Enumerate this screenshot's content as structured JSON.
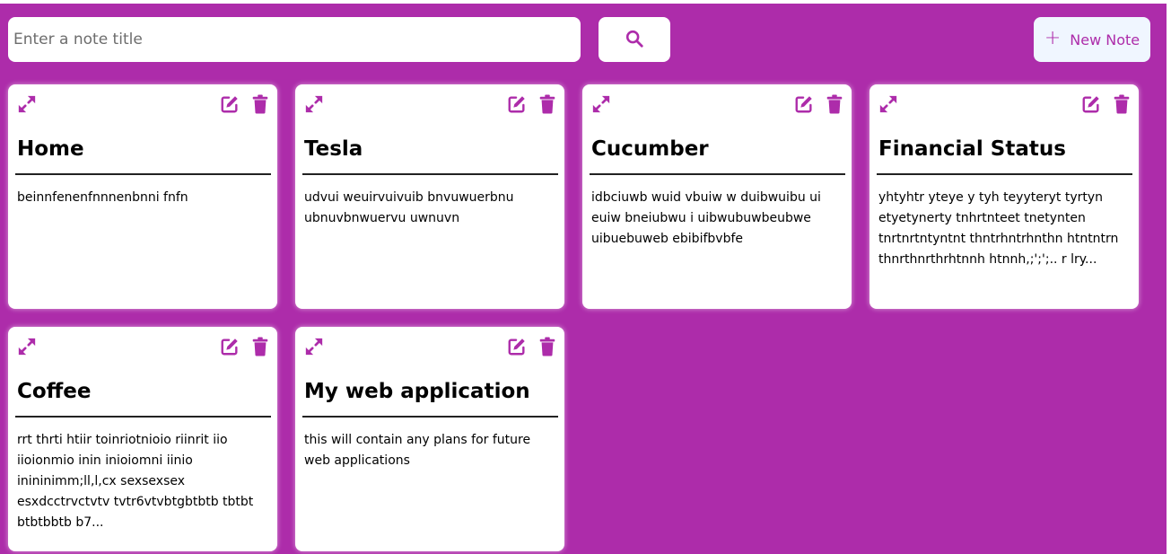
{
  "search": {
    "placeholder": "Enter a note title",
    "value": ""
  },
  "toolbar": {
    "search_icon": "search-icon",
    "new_note_label": "New Note",
    "new_note_icon": "plus-icon"
  },
  "colors": {
    "background": "#ad2caa",
    "accent": "#ad2caa",
    "card": "#ffffff",
    "new_note_bg": "#f0f6ff"
  },
  "notes": [
    {
      "title": "Home",
      "body": "beinnfenenfnnnenbnni fnfn"
    },
    {
      "title": "Tesla",
      "body": "udvui weuirvuivuib bnvuwuerbnu ubnuvbnwuervu uwnuvn"
    },
    {
      "title": "Cucumber",
      "body": "idbciuwb wuid vbuiw w duibwuibu ui euiw bneiubwu i uibwubuwbeubwe uibuebuweb ebibifbvbfe"
    },
    {
      "title": "Financial Status",
      "body": "yhtyhtr yteye y tyh teyyteryt tyrtyn etyetynerty tnhrtnteet tnetynten tnrtnrtntyntnt thntrhntrhnthn htntntrn thnrthnrthrhtnnh htnnh,;';';.. r lry..."
    },
    {
      "title": "Coffee",
      "body": "rrt thrti htiir toinriotnioio riinrit iio iioionmio inin inioiomni iinio inininimm;ll,l,cx sexsexsex esxdcctrvctvtv tvtr6vtvbtgbtbtb tbtbt btbtbbtb b7..."
    },
    {
      "title": "My web application",
      "body": "this will contain any plans for future web applications"
    }
  ],
  "card_icons": [
    "expand-icon",
    "edit-icon",
    "trash-icon"
  ]
}
